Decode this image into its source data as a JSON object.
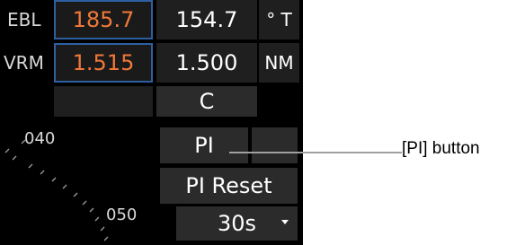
{
  "ebl": {
    "label": "EBL",
    "value1": "185.7",
    "value2": "154.7",
    "unit": "° T"
  },
  "vrm": {
    "label": "VRM",
    "value1": "1.515",
    "value2": "1.500",
    "unit": "NM"
  },
  "c_button": "C",
  "radar": {
    "bearing_040": "040",
    "bearing_050": "050"
  },
  "pi_button": "PI",
  "pi_reset_button": "PI Reset",
  "interval_select": {
    "value": "30s"
  },
  "annotation": "[PI] button",
  "colors": {
    "panel_bg": "#000000",
    "orange_value": "#f07838",
    "cell_border": "#2e5fa0",
    "button_bg": "#2b2b2b"
  }
}
